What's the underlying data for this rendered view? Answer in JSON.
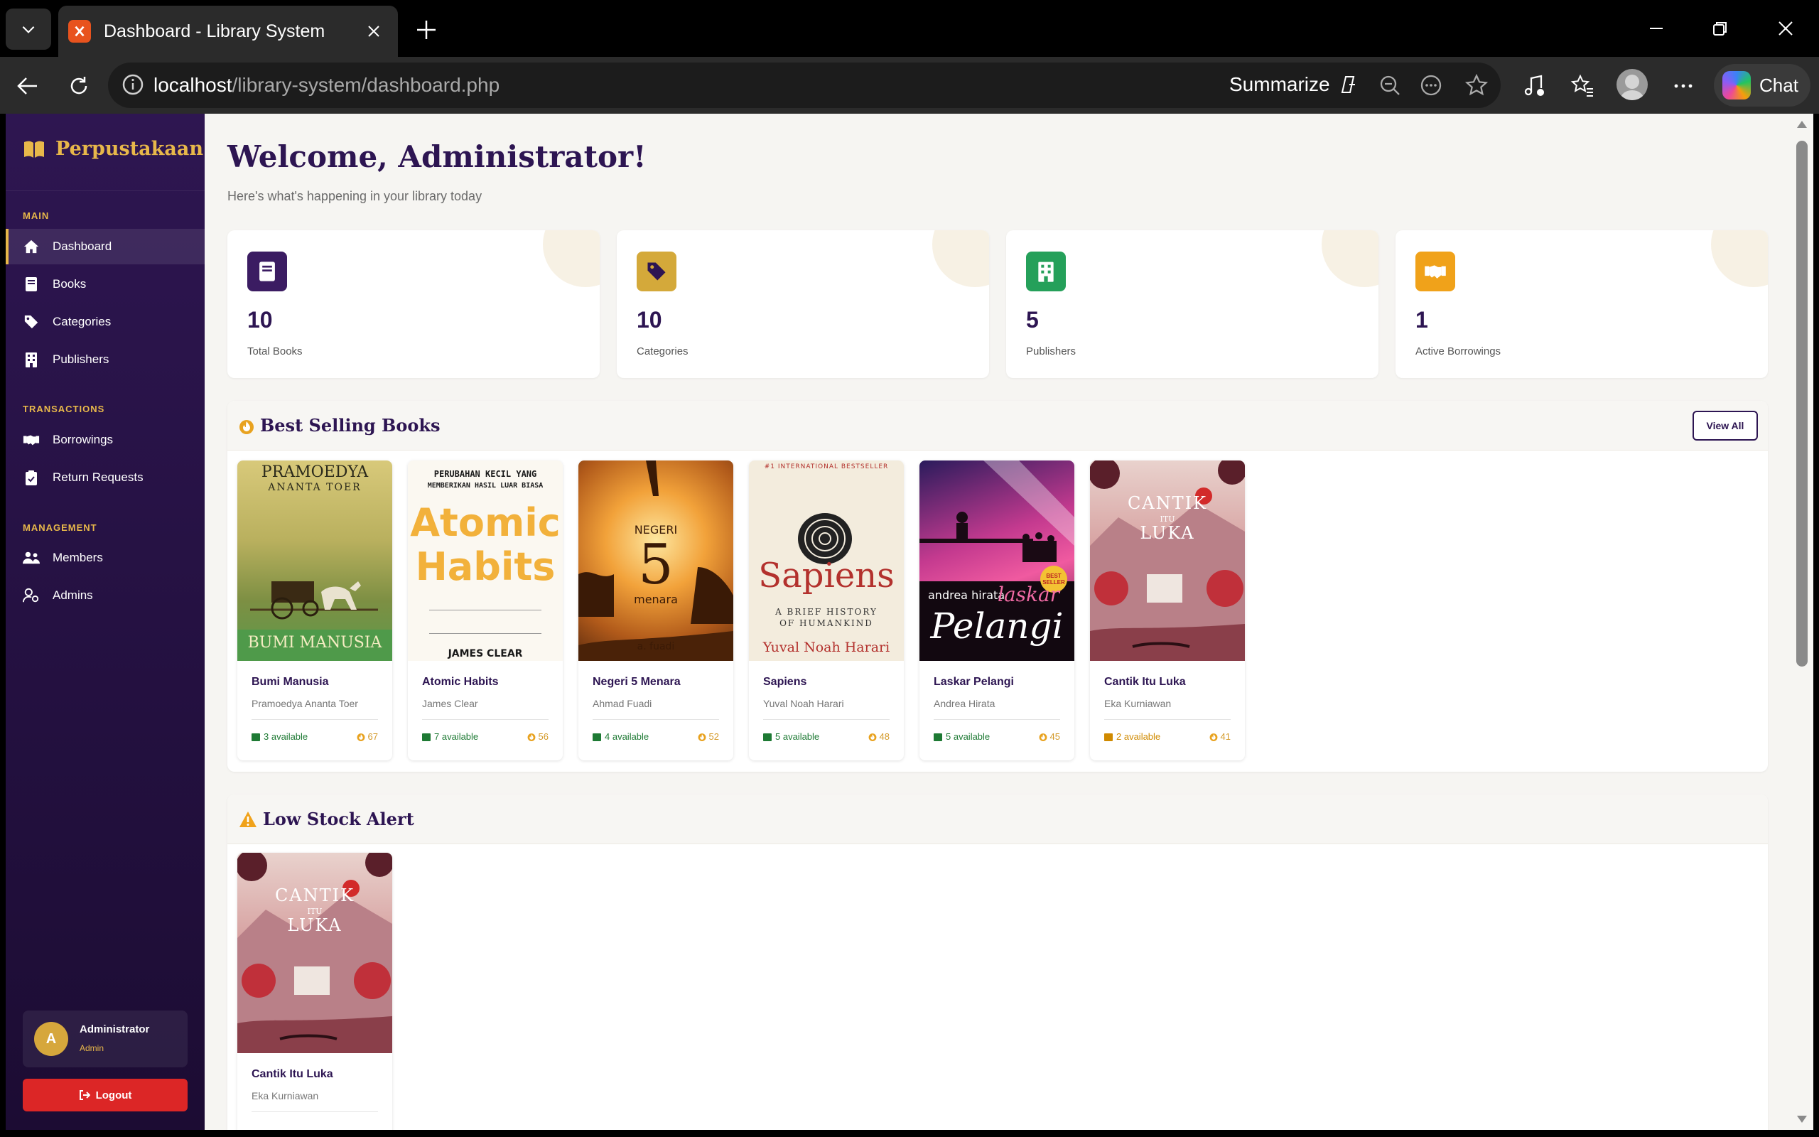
{
  "browser": {
    "tab_title": "Dashboard - Library System",
    "url_host": "localhost",
    "url_path": "/library-system/dashboard.php",
    "summarize_label": "Summarize",
    "chat_label": "Chat"
  },
  "sidebar": {
    "brand": "Perpustakaan",
    "sections": {
      "main": "MAIN",
      "transactions": "TRANSACTIONS",
      "management": "MANAGEMENT"
    },
    "items": [
      {
        "label": "Dashboard",
        "icon": "home-icon",
        "active": true
      },
      {
        "label": "Books",
        "icon": "book-icon"
      },
      {
        "label": "Categories",
        "icon": "tags-icon"
      },
      {
        "label": "Publishers",
        "icon": "building-icon"
      },
      {
        "label": "Borrowings",
        "icon": "handshake-icon"
      },
      {
        "label": "Return Requests",
        "icon": "clipboard-check-icon"
      },
      {
        "label": "Members",
        "icon": "users-icon"
      },
      {
        "label": "Admins",
        "icon": "user-cog-icon"
      }
    ],
    "user": {
      "initial": "A",
      "name": "Administrator",
      "role": "Admin"
    },
    "logout_label": "Logout"
  },
  "main": {
    "welcome": "Welcome, Administrator!",
    "subtitle": "Here's what's happening in your library today",
    "stats": [
      {
        "value": "10",
        "label": "Total Books",
        "icon": "book-icon",
        "color": "#3b1c62"
      },
      {
        "value": "10",
        "label": "Categories",
        "icon": "tags-icon",
        "color": "#d4a93a"
      },
      {
        "value": "5",
        "label": "Publishers",
        "icon": "building-icon",
        "color": "#25a05a"
      },
      {
        "value": "1",
        "label": "Active Borrowings",
        "icon": "handshake-icon",
        "color": "#f0a21a"
      }
    ],
    "best_selling": {
      "title": "Best Selling Books",
      "view_all": "View All",
      "books": [
        {
          "title": "Bumi Manusia",
          "author": "Pramoedya Ananta Toer",
          "available": "3 available",
          "sold": "67",
          "cover_top": "PRAMOEDYA",
          "cover_top2": "ANANTA TOER",
          "cover_title": "BUMI MANUSIA"
        },
        {
          "title": "Atomic Habits",
          "author": "James Clear",
          "available": "7 available",
          "sold": "56",
          "cover_top": "PERUBAHAN KECIL YANG",
          "cover_top2": "MEMBERIKAN HASIL LUAR BIASA",
          "cover_title": "Atomic",
          "cover_title2": "Habits",
          "cover_author": "JAMES CLEAR"
        },
        {
          "title": "Negeri 5 Menara",
          "author": "Ahmad Fuadi",
          "available": "4 available",
          "sold": "52",
          "cover_top": "NEGERI",
          "cover_title": "5",
          "cover_title2": "menara",
          "cover_author": "a. fuadi"
        },
        {
          "title": "Sapiens",
          "author": "Yuval Noah Harari",
          "available": "5 available",
          "sold": "48",
          "cover_top": "#1 INTERNATIONAL BESTSELLER",
          "cover_title": "Sapiens",
          "cover_sub": "A BRIEF HISTORY",
          "cover_sub2": "OF HUMANKIND",
          "cover_author": "Yuval Noah Harari"
        },
        {
          "title": "Laskar Pelangi",
          "author": "Andrea Hirata",
          "available": "5 available",
          "sold": "45",
          "cover_top": "andrea hirata",
          "cover_title": "laskar",
          "cover_title2": "Pelangi",
          "cover_badge": "BEST SELLER"
        },
        {
          "title": "Cantik Itu Luka",
          "author": "Eka Kurniawan",
          "available": "2 available",
          "sold": "41",
          "low": true,
          "cover_title": "CANTIK",
          "cover_mid": "ITU",
          "cover_title2": "LUKA"
        }
      ]
    },
    "low_stock": {
      "title": "Low Stock Alert",
      "books": [
        {
          "title": "Cantik Itu Luka",
          "author": "Eka Kurniawan",
          "cover_title": "CANTIK",
          "cover_mid": "ITU",
          "cover_title2": "LUKA"
        }
      ]
    }
  }
}
